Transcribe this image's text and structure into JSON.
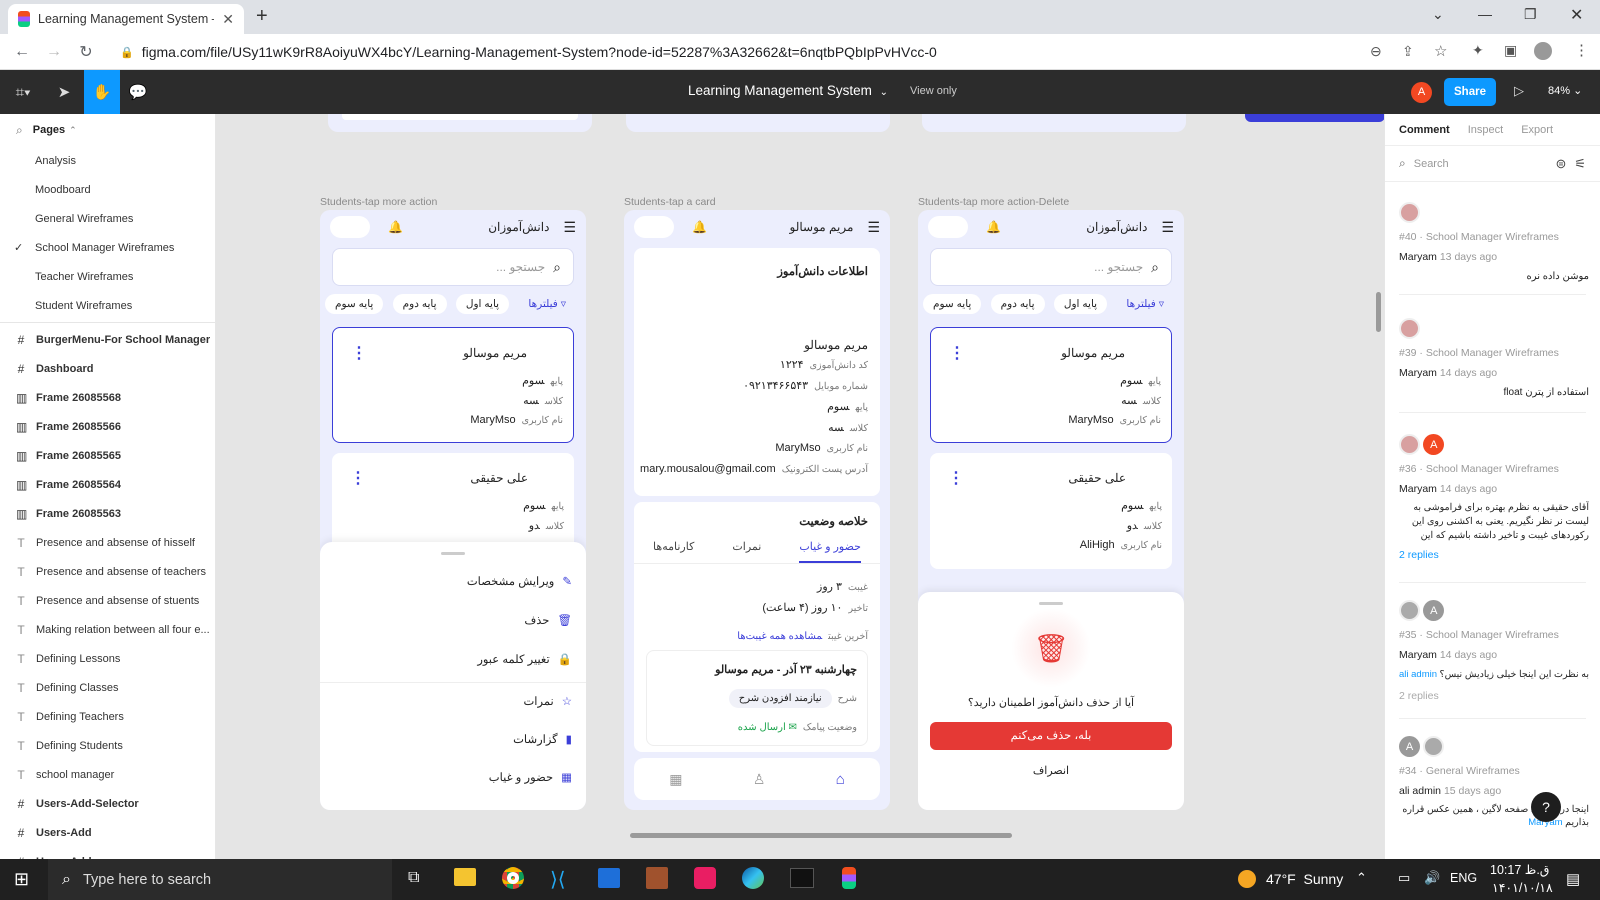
{
  "browser": {
    "tab_title": "Learning Management System – F",
    "url": "figma.com/file/USy11wK9rR8AoiyuWX4bcY/Learning-Management-System?node-id=52287%3A32662&t=6nqtbPQbIpPvHVcc-0"
  },
  "figma": {
    "file_title": "Learning Management System",
    "view_only": "View only",
    "share": "Share",
    "zoom": "84%",
    "avatar": "A"
  },
  "pages_panel": {
    "header": "Pages",
    "pages": [
      "Analysis",
      "Moodboard",
      "General Wireframes",
      "School Manager Wireframes",
      "Teacher Wireframes",
      "Student Wireframes"
    ],
    "layers": [
      {
        "icon": "#",
        "label": "BurgerMenu-For School Manager",
        "bold": true
      },
      {
        "icon": "#",
        "label": "Dashboard",
        "bold": true
      },
      {
        "icon": "frame",
        "label": "Frame 26085568",
        "bold": true
      },
      {
        "icon": "frame",
        "label": "Frame 26085566",
        "bold": true
      },
      {
        "icon": "frame",
        "label": "Frame 26085565",
        "bold": true
      },
      {
        "icon": "frame",
        "label": "Frame 26085564",
        "bold": true
      },
      {
        "icon": "frame",
        "label": "Frame 26085563",
        "bold": true
      },
      {
        "icon": "T",
        "label": "Presence and absense of hisself",
        "bold": false
      },
      {
        "icon": "T",
        "label": "Presence and absense of teachers",
        "bold": false
      },
      {
        "icon": "T",
        "label": "Presence and absense of stuents",
        "bold": false
      },
      {
        "icon": "T",
        "label": "Making relation between all four e...",
        "bold": false
      },
      {
        "icon": "T",
        "label": "Defining Lessons",
        "bold": false
      },
      {
        "icon": "T",
        "label": "Defining Classes",
        "bold": false
      },
      {
        "icon": "T",
        "label": "Defining Teachers",
        "bold": false
      },
      {
        "icon": "T",
        "label": "Defining Students",
        "bold": false
      },
      {
        "icon": "T",
        "label": "school manager",
        "bold": false
      },
      {
        "icon": "#",
        "label": "Users-Add-Selector",
        "bold": true
      },
      {
        "icon": "#",
        "label": "Users-Add",
        "bold": true
      },
      {
        "icon": "#",
        "label": "Users-Add",
        "bold": true
      }
    ]
  },
  "frames": {
    "f1": {
      "label": "Students-tap more action",
      "title": "دانش‌آموزان",
      "search_placeholder": "جستجو ...",
      "chips": [
        "فیلترها",
        "پایه اول",
        "پایه دوم",
        "پایه سوم"
      ],
      "card1": {
        "name": "مریم موسالو",
        "k1": "پایه",
        "v1": "سوم",
        "k2": "کلاس",
        "v2": "سه",
        "k3": "نام کاربری",
        "v3": "MaryMso"
      },
      "card2": {
        "name": "علی حقیقی",
        "k1": "پایه",
        "v1": "سوم",
        "k2": "کلاس",
        "v2": "دو"
      },
      "menu": [
        "ویرایش مشخصات",
        "حذف",
        "تغییر کلمه عبور",
        "نمرات",
        "گزارشات",
        "حضور و غیاب"
      ]
    },
    "f2": {
      "label": "Students-tap a card",
      "title": "مریم موسالو",
      "info_title": "اطلاعات دانش‌آموز",
      "name": "مریم موسالو",
      "rows": [
        {
          "k": "کد دانش‌آموزی",
          "v": "۱۲۲۴"
        },
        {
          "k": "شماره موبایل",
          "v": "۰۹۲۱۳۴۶۶۵۴۳"
        },
        {
          "k": "پایه",
          "v": "سوم"
        },
        {
          "k": "کلاس",
          "v": "سه"
        },
        {
          "k": "نام کاربری",
          "v": "MaryMso"
        },
        {
          "k": "آدرس پست الکترونیک",
          "v": "mary.mousalou@gmail.com"
        }
      ],
      "status_title": "خلاصه وضعیت",
      "tabs": [
        "حضور و غیاب",
        "نمرات",
        "کارنامه‌ها"
      ],
      "absence_k": "غیبت",
      "absence_v": "۳ روز",
      "delay_k": "تاخیر",
      "delay_v": "۱۰ روز (۴ ساعت)",
      "last_absence": "آخرین غیبت",
      "see_all": "مشاهده همه غیبت‌ها",
      "entry_title": "چهارشنبه ۲۳ آذر - مریم موسالو",
      "desc_k": "شرح",
      "desc_v": "نیازمند افزودن شرح",
      "sms_k": "وضعیت پیامک",
      "sms_v": "ارسال شده"
    },
    "f3": {
      "label": "Students-tap more action-Delete",
      "title": "دانش‌آموزان",
      "search_placeholder": "جستجو ...",
      "chips": [
        "فیلترها",
        "پایه اول",
        "پایه دوم",
        "پایه سوم"
      ],
      "card1": {
        "name": "مریم موسالو",
        "k1": "پایه",
        "v1": "سوم",
        "k2": "کلاس",
        "v2": "سه",
        "k3": "نام کاربری",
        "v3": "MaryMso"
      },
      "card2": {
        "name": "علی حقیقی",
        "k1": "پایه",
        "v1": "سوم",
        "k2": "کلاس",
        "v2": "دو",
        "k3": "نام کاربری",
        "v3": "AliHigh"
      },
      "question": "آیا از حذف دانش‌آموز اطمینان دارید؟",
      "confirm": "بله، حذف می‌کنم",
      "cancel": "انصراف"
    }
  },
  "comments_panel": {
    "tabs": [
      "Comment",
      "Inspect",
      "Export"
    ],
    "search_placeholder": "Search",
    "comments": [
      {
        "ref": "#40 · School Manager Wireframes",
        "author": "Maryam",
        "time": "13 days ago",
        "text": "موشن داده نره",
        "replies": ""
      },
      {
        "ref": "#39 · School Manager Wireframes",
        "author": "Maryam",
        "time": "14 days ago",
        "text": "استفاده از پترن float",
        "replies": ""
      },
      {
        "ref": "#36 · School Manager Wireframes",
        "author": "Maryam",
        "time": "14 days ago",
        "text": "آقای حقیقی به نظرم بهتره برای فراموشی به لیست نر نظر نگیریم. یعنی به اکشنی روی این رکوردهای غیبت و تاخیر داشته باشیم که این رکوردها رو به فراموشی کار...",
        "replies": "2 replies"
      },
      {
        "ref": "#35 · School Manager Wireframes",
        "author": "Maryam",
        "time": "14 days ago",
        "text": "به نظرت این اینجا خیلی زیادیش نیس؟",
        "mention": "ali admin",
        "replies": "2 replies"
      },
      {
        "ref": "#34 · General Wireframes",
        "author": "ali admin",
        "time": "15 days ago",
        "text": "اینجا دربر مورد صفحه لاگین ، همین عکس قراره بذاریم",
        "mention": "Maryam",
        "replies": ""
      }
    ]
  },
  "taskbar": {
    "search": "Type here to search",
    "weather": "47°F  Sunny",
    "lang": "ENG",
    "time": "10:17 ق.ظ",
    "date": "۱۴۰۱/۱۰/۱۸"
  }
}
